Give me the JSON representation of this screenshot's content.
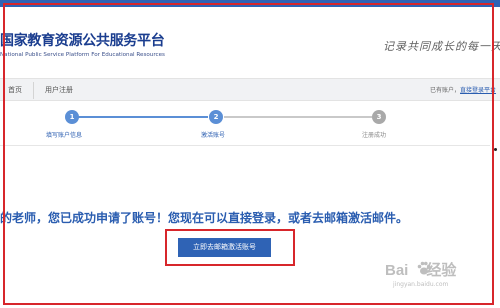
{
  "header": {
    "title": "国家教育资源公共服务平台",
    "subtitle": "National Public  Service Platform For Educational Resources",
    "slogan": "记录共同成长的每一天"
  },
  "breadcrumb": {
    "home": "首页",
    "current": "用户注册",
    "account_prompt": "已有账户，",
    "login_link": "直接登录平台"
  },
  "steps": [
    {
      "number": "1",
      "label": "填写账户信息",
      "state": "done"
    },
    {
      "number": "2",
      "label": "激活账号",
      "state": "active"
    },
    {
      "number": "3",
      "label": "注册成功",
      "state": "pending"
    }
  ],
  "message": "的老师，您已成功申请了账号！您现在可以直接登录，或者去邮箱激活邮件。",
  "activate_button": "立即去邮箱激活账号",
  "watermark": {
    "text_left": "Bai",
    "text_right": "经验",
    "sub": "jingyan.baidu.com"
  },
  "colors": {
    "brand_blue": "#2f63b5",
    "step_active": "#5b8fd6",
    "step_pending": "#a9a9a9",
    "highlight_red": "#d7262b"
  }
}
